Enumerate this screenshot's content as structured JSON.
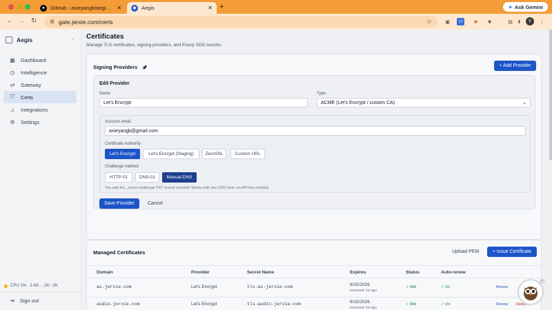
{
  "browser": {
    "tabs": [
      {
        "title": "GitHub - axieyangb/aegis: Se",
        "icon": "github-icon"
      },
      {
        "title": "Aegis",
        "icon": "shield-icon"
      }
    ],
    "new_tab": "+",
    "ask_gemini": "Ask Gemini",
    "url": "gate.jerxie.com/certs",
    "profile_initial": "Y",
    "ext_badge": "17"
  },
  "sidebar": {
    "brand": "Aegis",
    "items": [
      {
        "label": "Dashboard",
        "icon": "grid-icon"
      },
      {
        "label": "Intelligence",
        "icon": "clock-icon"
      },
      {
        "label": "Gateway",
        "icon": "arrows-icon"
      },
      {
        "label": "Certs",
        "icon": "shield-check-icon"
      },
      {
        "label": "Integrations",
        "icon": "bell-icon"
      },
      {
        "label": "Settings",
        "icon": "gear-icon"
      }
    ],
    "active": "Certs",
    "cpu_status": "CPU 1% · 2.4G · ↓2K ↑2K",
    "sign_out": "Sign out"
  },
  "page": {
    "title": "Certificates",
    "subtitle": "Manage TLS certificates, signing providers, and Envoy SDS secrets."
  },
  "signing": {
    "title": "Signing Providers",
    "add_button": "+ Add Provider",
    "edit": {
      "title": "Edit Provider",
      "name_label": "Name",
      "name_value": "Let's Encrypt",
      "type_label": "Type",
      "type_value": "ACME (Let's Encrypt / custom CA)",
      "email_label": "Account email",
      "email_value": "axieyangb@gmail.com",
      "ca_label": "Certificate Authority",
      "ca_options": [
        "Let's Encrypt",
        "Let's Encrypt (Staging)",
        "ZeroSSL",
        "Custom URL"
      ],
      "ca_selected": 0,
      "challenge_label": "Challenge method",
      "challenge_options": [
        "HTTP-01",
        "DNS-01",
        "Manual DNS"
      ],
      "challenge_selected": 2,
      "challenge_hint": "You add the _acme-challenge TXT record yourself. Works with any DNS host, no API key needed.",
      "save": "Save Provider",
      "cancel": "Cancel"
    }
  },
  "managed": {
    "title": "Managed Certificates",
    "upload": "Upload PEM",
    "issue": "+ Issue Certificate",
    "columns": [
      "Domain",
      "Provider",
      "Secret Name",
      "Expires",
      "Status",
      "Auto-renew"
    ],
    "rows": [
      {
        "domain": "ai.jerxie.com",
        "provider": "Let's Encrypt",
        "secret": "tls-ai-jerxie-com",
        "expires": "8/15/2026",
        "renewed": "renewed 1d ago",
        "status": "✓ 88d",
        "auto": "✓ On",
        "action": "Renew",
        "action2": ""
      },
      {
        "domain": "audio.jerxie.com",
        "provider": "Let's Encrypt",
        "secret": "tls-audio-jerxie-com",
        "expires": "8/15/2026",
        "renewed": "renewed 1d ago",
        "status": "✓ 88d",
        "auto": "✓ On",
        "action": "Renew",
        "action2": "Delete"
      }
    ]
  }
}
